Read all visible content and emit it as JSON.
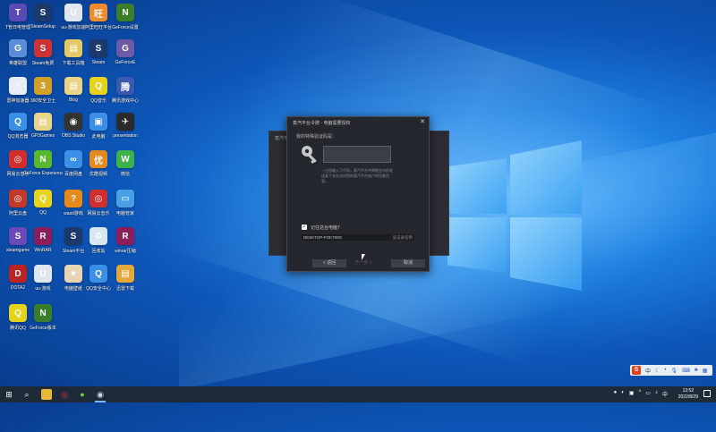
{
  "desktop": {
    "icons": [
      {
        "label": "T管日电管理",
        "color": "#5a4ab8",
        "glyph": "T"
      },
      {
        "label": "SteamSetup",
        "color": "#1b3a6b",
        "glyph": "S"
      },
      {
        "label": "uu-游戏加速",
        "color": "#e0e6ef",
        "glyph": "U"
      },
      {
        "label": "阿里旺旺平台",
        "color": "#f08a2c",
        "glyph": "旺"
      },
      {
        "label": "GeForce设置",
        "color": "#3a7d2a",
        "glyph": "N"
      },
      {
        "label": "英雄联盟",
        "color": "#5b8ed6",
        "glyph": "G"
      },
      {
        "label": "Steam免费",
        "color": "#c33",
        "glyph": "S"
      },
      {
        "label": "下载工具箱",
        "color": "#e4c96a",
        "glyph": "▤"
      },
      {
        "label": "Steam",
        "color": "#1b3a6b",
        "glyph": "S"
      },
      {
        "label": "GeForceE",
        "color": "#6b5aa8",
        "glyph": "G"
      },
      {
        "label": "雷神加速器",
        "color": "#e8eef7",
        "glyph": "⚡"
      },
      {
        "label": "360安全卫士",
        "color": "#d2a02a",
        "glyph": "3"
      },
      {
        "label": "Blog",
        "color": "#e8d58a",
        "glyph": "▤"
      },
      {
        "label": "QQ音乐",
        "color": "#e6d31c",
        "glyph": "Q"
      },
      {
        "label": "腾讯游戏中心",
        "color": "#3a5ab0",
        "glyph": "腾"
      },
      {
        "label": "QQ浏览器",
        "color": "#3b8fe6",
        "glyph": "Q"
      },
      {
        "label": "GP3Games",
        "color": "#e8d58a",
        "glyph": "▤"
      },
      {
        "label": "OBS Studio",
        "color": "#333",
        "glyph": "◉"
      },
      {
        "label": "此电脑",
        "color": "#3b8fe6",
        "glyph": "▣"
      },
      {
        "label": "presentation",
        "color": "#2a2a2a",
        "glyph": "✈"
      },
      {
        "label": "网易云音乐",
        "color": "#d12e2e",
        "glyph": "◎"
      },
      {
        "label": "GeForce Experience",
        "color": "#5ab82e",
        "glyph": "N"
      },
      {
        "label": "百度网盘",
        "color": "#3b8fe6",
        "glyph": "∞"
      },
      {
        "label": "优酷视频",
        "color": "#e58a1e",
        "glyph": "优"
      },
      {
        "label": "微信",
        "color": "#3cb34a",
        "glyph": "W"
      },
      {
        "label": "阿里云盘",
        "color": "#c0392b",
        "glyph": "◎"
      },
      {
        "label": "QQ",
        "color": "#e6d31c",
        "glyph": "Q"
      },
      {
        "label": "wasd游戏",
        "color": "#e68a1e",
        "glyph": "?"
      },
      {
        "label": "网易云音乐",
        "color": "#d12e2e",
        "glyph": "◎"
      },
      {
        "label": "电脑管家",
        "color": "#4aa0e6",
        "glyph": "▭"
      },
      {
        "label": "steamgame",
        "color": "#6b4ab8",
        "glyph": "S"
      },
      {
        "label": "WinRAR",
        "color": "#8b1e5a",
        "glyph": "R"
      },
      {
        "label": "Steam平台",
        "color": "#1b3a6b",
        "glyph": "S"
      },
      {
        "label": "回收站",
        "color": "#d8e6f2",
        "glyph": "♻"
      },
      {
        "label": "winrar压缩",
        "color": "#8b1e5a",
        "glyph": "R"
      },
      {
        "label": "DOTA2",
        "color": "#b22",
        "glyph": "D"
      },
      {
        "label": "uu-游戏",
        "color": "#e0e6ef",
        "glyph": "U"
      },
      {
        "label": "电脑壁纸",
        "color": "#e8d5b5",
        "glyph": "♥"
      },
      {
        "label": "QQ安全中心",
        "color": "#3b8fe6",
        "glyph": "Q"
      },
      {
        "label": "迅雷下载",
        "color": "#e4a83a",
        "glyph": "▤"
      },
      {
        "label": "腾讯QQ",
        "color": "#e6d31c",
        "glyph": "Q"
      },
      {
        "label": "GeForce版本",
        "color": "#3a7d2a",
        "glyph": "N"
      }
    ]
  },
  "dialog_bg": {
    "title": "蒸汽平台"
  },
  "dialog": {
    "title": "蒸汽平台令牌 - 电脑需要授权",
    "prompt": "我的特殊验证码是：",
    "code_value": "",
    "hint": "一旦您输入了代码，蒸汽平台令牌就会向你发送某个允许访问您的蒸汽平台账户的设备列表。",
    "remember_label": "记住这台电脑？",
    "device_name": "DESKTOP-FOK700G",
    "device_action": "该记录名称",
    "back_label": "< 返回",
    "next_label": "下一步 >",
    "cancel_label": "取消"
  },
  "ime": {
    "logo": "S",
    "lang": "中"
  },
  "taskbar": {
    "time": "13:52",
    "date": "2022/8/29"
  }
}
